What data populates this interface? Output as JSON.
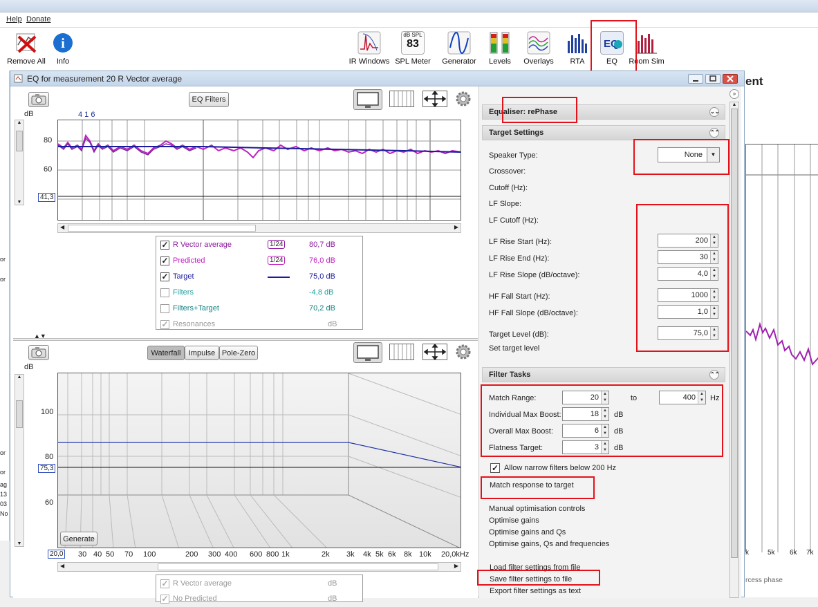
{
  "menu": {
    "help": "Help",
    "donate": "Donate"
  },
  "toolbar": {
    "remove_all": "Remove All",
    "info": "Info",
    "ir_windows": "IR Windows",
    "spl_meter": "SPL Meter",
    "spl_meter_top": "dB SPL",
    "spl_value": "83",
    "generator": "Generator",
    "levels": "Levels",
    "overlays": "Overlays",
    "rta": "RTA",
    "eq": "EQ",
    "eq_icon_text": "EQ",
    "room_sim": "Room Sim"
  },
  "background_window": {
    "title_fragment": "ent",
    "freq_labels": [
      "k",
      "5k",
      "6k",
      "7k"
    ],
    "caption_fragment": "rcess phase",
    "left_fragments": [
      "or",
      "or",
      "or",
      "or",
      "ag",
      "13",
      "03",
      "No"
    ]
  },
  "eq_window": {
    "title": "EQ for measurement 20 R Vector average",
    "top_graph": {
      "eq_filters_button": "EQ Filters",
      "db_label": "dB",
      "top_markers": "4 1  6",
      "y_ticks": [
        "80",
        "60"
      ],
      "cursor_value": "41,3"
    },
    "legend": [
      {
        "label": "R Vector average",
        "smoothing": "1/24",
        "value": "80,7 dB",
        "color": "#8b1a9e",
        "checked": true
      },
      {
        "label": "Predicted",
        "smoothing": "1/24",
        "value": "76,0 dB",
        "color": "#c020c0",
        "checked": true
      },
      {
        "label": "Target",
        "smoothing": "",
        "value": "75,0 dB",
        "color": "#1a1aa0",
        "checked": true
      },
      {
        "label": "Filters",
        "smoothing": "",
        "value": "-4,8 dB",
        "color": "#20a0a0",
        "checked": false
      },
      {
        "label": "Filters+Target",
        "smoothing": "",
        "value": "70,2 dB",
        "color": "#108080",
        "checked": false
      },
      {
        "label": "Resonances",
        "smoothing": "",
        "value": "dB",
        "color": "#999999",
        "checked": true
      }
    ],
    "bottom_graph": {
      "tabs": [
        "Waterfall",
        "Impulse",
        "Pole-Zero"
      ],
      "db_label": "dB",
      "y_ticks": [
        "100",
        "80",
        "60"
      ],
      "cursor_value": "75,3",
      "generate_button": "Generate",
      "x_start": "20,0",
      "x_ticks": [
        "30",
        "40",
        "50",
        "70",
        "100",
        "200",
        "300",
        "400",
        "600",
        "800",
        "1k",
        "2k",
        "3k",
        "4k",
        "5k",
        "6k",
        "8k",
        "10k",
        "20,0kHz"
      ]
    },
    "bottom_legend": [
      {
        "label": "R Vector average",
        "value": "dB"
      },
      {
        "label": "No Predicted",
        "value": "dB"
      }
    ]
  },
  "right_panel": {
    "equaliser_header": "Equaliser: rePhase",
    "target_settings_header": "Target Settings",
    "speaker_type_label": "Speaker Type:",
    "speaker_type_value": "None",
    "crossover_label": "Crossover:",
    "cutoff_label": "Cutoff (Hz):",
    "lf_slope_label": "LF Slope:",
    "lf_cutoff_label": "LF Cutoff (Hz):",
    "lf_rise_start_label": "LF Rise Start (Hz):",
    "lf_rise_start_value": "200",
    "lf_rise_end_label": "LF Rise End (Hz):",
    "lf_rise_end_value": "30",
    "lf_rise_slope_label": "LF Rise Slope (dB/octave):",
    "lf_rise_slope_value": "4,0",
    "hf_fall_start_label": "HF Fall Start (Hz):",
    "hf_fall_start_value": "1000",
    "hf_fall_slope_label": "HF Fall Slope (dB/octave):",
    "hf_fall_slope_value": "1,0",
    "target_level_label": "Target Level (dB):",
    "target_level_value": "75,0",
    "set_target_level": "Set target level",
    "filter_tasks_header": "Filter Tasks",
    "match_range_label": "Match Range:",
    "match_range_from": "20",
    "match_range_to_label": "to",
    "match_range_to": "400",
    "hz_unit": "Hz",
    "individual_max_boost_label": "Individual Max Boost:",
    "individual_max_boost_value": "18",
    "overall_max_boost_label": "Overall Max Boost:",
    "overall_max_boost_value": "6",
    "flatness_target_label": "Flatness Target:",
    "flatness_target_value": "3",
    "db_unit": "dB",
    "allow_narrow_label": "Allow narrow filters below 200 Hz",
    "match_response_button": "Match response to target",
    "manual_opt_header": "Manual optimisation controls",
    "optimise_gains": "Optimise gains",
    "optimise_gains_qs": "Optimise gains and Qs",
    "optimise_gains_qs_freq": "Optimise gains, Qs and frequencies",
    "load_filter_settings": "Load filter settings from file",
    "save_filter_settings": "Save filter settings to file",
    "export_filter_settings": "Export filter settings as text"
  },
  "colors": {
    "highlight_red": "#e3121a",
    "measurement": "#8b1a9e",
    "predicted": "#c020c0",
    "target": "#1a1aa0"
  }
}
